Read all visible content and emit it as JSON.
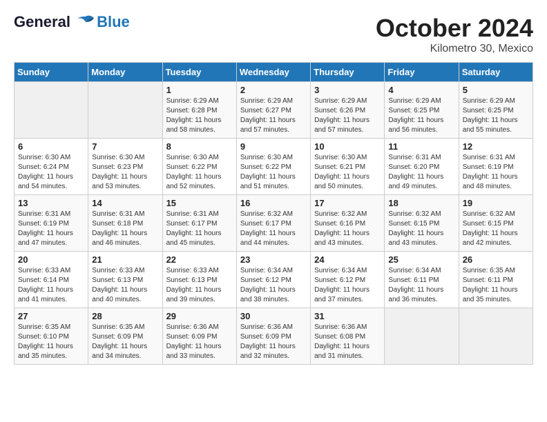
{
  "header": {
    "logo_line1": "General",
    "logo_line2": "Blue",
    "month": "October 2024",
    "location": "Kilometro 30, Mexico"
  },
  "days_of_week": [
    "Sunday",
    "Monday",
    "Tuesday",
    "Wednesday",
    "Thursday",
    "Friday",
    "Saturday"
  ],
  "weeks": [
    [
      {
        "day": "",
        "info": ""
      },
      {
        "day": "",
        "info": ""
      },
      {
        "day": "1",
        "info": "Sunrise: 6:29 AM\nSunset: 6:28 PM\nDaylight: 11 hours and 58 minutes."
      },
      {
        "day": "2",
        "info": "Sunrise: 6:29 AM\nSunset: 6:27 PM\nDaylight: 11 hours and 57 minutes."
      },
      {
        "day": "3",
        "info": "Sunrise: 6:29 AM\nSunset: 6:26 PM\nDaylight: 11 hours and 57 minutes."
      },
      {
        "day": "4",
        "info": "Sunrise: 6:29 AM\nSunset: 6:25 PM\nDaylight: 11 hours and 56 minutes."
      },
      {
        "day": "5",
        "info": "Sunrise: 6:29 AM\nSunset: 6:25 PM\nDaylight: 11 hours and 55 minutes."
      }
    ],
    [
      {
        "day": "6",
        "info": "Sunrise: 6:30 AM\nSunset: 6:24 PM\nDaylight: 11 hours and 54 minutes."
      },
      {
        "day": "7",
        "info": "Sunrise: 6:30 AM\nSunset: 6:23 PM\nDaylight: 11 hours and 53 minutes."
      },
      {
        "day": "8",
        "info": "Sunrise: 6:30 AM\nSunset: 6:22 PM\nDaylight: 11 hours and 52 minutes."
      },
      {
        "day": "9",
        "info": "Sunrise: 6:30 AM\nSunset: 6:22 PM\nDaylight: 11 hours and 51 minutes."
      },
      {
        "day": "10",
        "info": "Sunrise: 6:30 AM\nSunset: 6:21 PM\nDaylight: 11 hours and 50 minutes."
      },
      {
        "day": "11",
        "info": "Sunrise: 6:31 AM\nSunset: 6:20 PM\nDaylight: 11 hours and 49 minutes."
      },
      {
        "day": "12",
        "info": "Sunrise: 6:31 AM\nSunset: 6:19 PM\nDaylight: 11 hours and 48 minutes."
      }
    ],
    [
      {
        "day": "13",
        "info": "Sunrise: 6:31 AM\nSunset: 6:19 PM\nDaylight: 11 hours and 47 minutes."
      },
      {
        "day": "14",
        "info": "Sunrise: 6:31 AM\nSunset: 6:18 PM\nDaylight: 11 hours and 46 minutes."
      },
      {
        "day": "15",
        "info": "Sunrise: 6:31 AM\nSunset: 6:17 PM\nDaylight: 11 hours and 45 minutes."
      },
      {
        "day": "16",
        "info": "Sunrise: 6:32 AM\nSunset: 6:17 PM\nDaylight: 11 hours and 44 minutes."
      },
      {
        "day": "17",
        "info": "Sunrise: 6:32 AM\nSunset: 6:16 PM\nDaylight: 11 hours and 43 minutes."
      },
      {
        "day": "18",
        "info": "Sunrise: 6:32 AM\nSunset: 6:15 PM\nDaylight: 11 hours and 43 minutes."
      },
      {
        "day": "19",
        "info": "Sunrise: 6:32 AM\nSunset: 6:15 PM\nDaylight: 11 hours and 42 minutes."
      }
    ],
    [
      {
        "day": "20",
        "info": "Sunrise: 6:33 AM\nSunset: 6:14 PM\nDaylight: 11 hours and 41 minutes."
      },
      {
        "day": "21",
        "info": "Sunrise: 6:33 AM\nSunset: 6:13 PM\nDaylight: 11 hours and 40 minutes."
      },
      {
        "day": "22",
        "info": "Sunrise: 6:33 AM\nSunset: 6:13 PM\nDaylight: 11 hours and 39 minutes."
      },
      {
        "day": "23",
        "info": "Sunrise: 6:34 AM\nSunset: 6:12 PM\nDaylight: 11 hours and 38 minutes."
      },
      {
        "day": "24",
        "info": "Sunrise: 6:34 AM\nSunset: 6:12 PM\nDaylight: 11 hours and 37 minutes."
      },
      {
        "day": "25",
        "info": "Sunrise: 6:34 AM\nSunset: 6:11 PM\nDaylight: 11 hours and 36 minutes."
      },
      {
        "day": "26",
        "info": "Sunrise: 6:35 AM\nSunset: 6:11 PM\nDaylight: 11 hours and 35 minutes."
      }
    ],
    [
      {
        "day": "27",
        "info": "Sunrise: 6:35 AM\nSunset: 6:10 PM\nDaylight: 11 hours and 35 minutes."
      },
      {
        "day": "28",
        "info": "Sunrise: 6:35 AM\nSunset: 6:09 PM\nDaylight: 11 hours and 34 minutes."
      },
      {
        "day": "29",
        "info": "Sunrise: 6:36 AM\nSunset: 6:09 PM\nDaylight: 11 hours and 33 minutes."
      },
      {
        "day": "30",
        "info": "Sunrise: 6:36 AM\nSunset: 6:09 PM\nDaylight: 11 hours and 32 minutes."
      },
      {
        "day": "31",
        "info": "Sunrise: 6:36 AM\nSunset: 6:08 PM\nDaylight: 11 hours and 31 minutes."
      },
      {
        "day": "",
        "info": ""
      },
      {
        "day": "",
        "info": ""
      }
    ]
  ]
}
